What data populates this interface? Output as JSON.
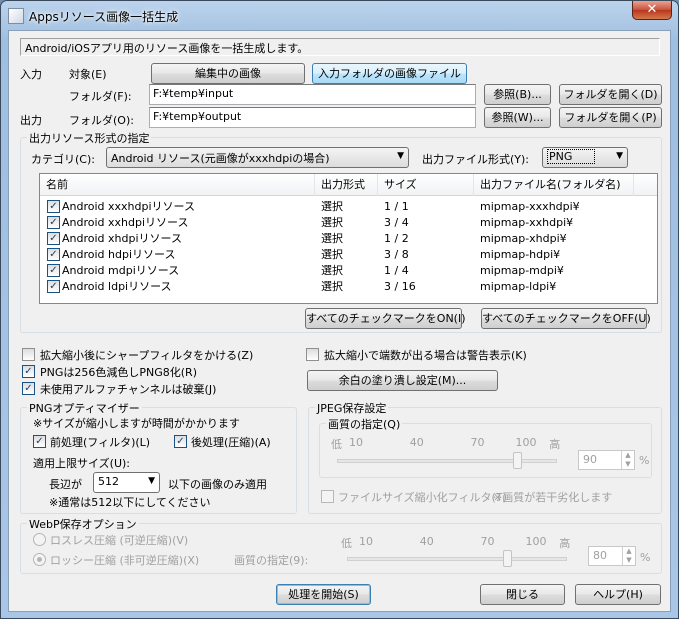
{
  "window": {
    "title": "Appsリソース画像一括生成",
    "close_label": "✕"
  },
  "description": "Android/iOSアプリ用のリソース画像を一括生成します。",
  "input": {
    "section_label": "入力",
    "target_label": "対象(E)",
    "target_btn_editing": "編集中の画像",
    "target_btn_folder": "入力フォルダの画像ファイル",
    "folder_label": "フォルダ(F):",
    "folder_value": "F:¥temp¥input",
    "browse_btn": "参照(B)...",
    "open_btn": "フォルダを開く(D)"
  },
  "output": {
    "section_label": "出力",
    "folder_label": "フォルダ(O):",
    "folder_value": "F:¥temp¥output",
    "browse_btn": "参照(W)...",
    "open_btn": "フォルダを開く(P)"
  },
  "resource_format": {
    "group_label": "出力リソース形式の指定",
    "category_label": "カテゴリ(C):",
    "category_value": "Android リソース(元画像がxxxhdpiの場合)",
    "file_format_label": "出力ファイル形式(Y):",
    "file_format_value": "PNG",
    "columns": [
      "名前",
      "出力形式",
      "サイズ",
      "出力ファイル名(フォルダ名)"
    ],
    "rows": [
      {
        "checked": true,
        "name": "Android xxxhdpiリソース",
        "format": "選択",
        "size": "1 / 1",
        "file": "mipmap-xxxhdpi¥"
      },
      {
        "checked": true,
        "name": "Android xxhdpiリソース",
        "format": "選択",
        "size": "3 / 4",
        "file": "mipmap-xxhdpi¥"
      },
      {
        "checked": true,
        "name": "Android xhdpiリソース",
        "format": "選択",
        "size": "1 / 2",
        "file": "mipmap-xhdpi¥"
      },
      {
        "checked": true,
        "name": "Android hdpiリソース",
        "format": "選択",
        "size": "3 / 8",
        "file": "mipmap-hdpi¥"
      },
      {
        "checked": true,
        "name": "Android mdpiリソース",
        "format": "選択",
        "size": "1 / 4",
        "file": "mipmap-mdpi¥"
      },
      {
        "checked": true,
        "name": "Android ldpiリソース",
        "format": "選択",
        "size": "3 / 16",
        "file": "mipmap-ldpi¥"
      }
    ],
    "check_all_on": "すべてのチェックマークをON(I)",
    "check_all_off": "すべてのチェックマークをOFF(U)"
  },
  "options": {
    "sharpen": {
      "checked": false,
      "label": "拡大縮小後にシャープフィルタをかける(Z)"
    },
    "png8": {
      "checked": true,
      "label": "PNGは256色減色しPNG8化(R)"
    },
    "discard_alpha": {
      "checked": true,
      "label": "未使用アルファチャンネルは破棄(J)"
    },
    "warn_fraction": {
      "checked": false,
      "label": "拡大縮小で端数が出る場合は警告表示(K)"
    },
    "margin_btn": "余白の塗り潰し設定(M)..."
  },
  "png_optimizer": {
    "group_label": "PNGオプティマイザー",
    "note": "※サイズが縮小しますが時間がかかります",
    "pre": {
      "checked": true,
      "label": "前処理(フィルタ)(L)"
    },
    "post": {
      "checked": true,
      "label": "後処理(圧縮)(A)"
    },
    "limit_label": "適用上限サイズ(U):",
    "long_side_label": "長辺が",
    "long_side_value": "512",
    "apply_suffix": "以下の画像のみ適用",
    "limit_note": "※通常は512以下にしてください"
  },
  "jpeg": {
    "group_label": "JPEG保存設定",
    "quality_label": "画質の指定(Q)",
    "scale": [
      "低",
      "10",
      "40",
      "70",
      "100",
      "高"
    ],
    "quality_value": "90",
    "quality_level": 90,
    "percent": "%",
    "filter_label": "ファイルサイズ縮小化フィルタ(T)",
    "filter_note": "※画質が若干劣化します"
  },
  "webp": {
    "group_label": "WebP保存オプション",
    "lossless_label": "ロスレス圧縮 (可逆圧縮)(V)",
    "lossy_label": "ロッシー圧縮 (非可逆圧縮)(X)",
    "quality_label": "画質の指定(9):",
    "scale": [
      "低",
      "10",
      "40",
      "70",
      "100",
      "高"
    ],
    "quality_value": "80",
    "quality_level": 80,
    "percent": "%"
  },
  "footer": {
    "start_btn": "処理を開始(S)",
    "close_btn": "閉じる",
    "help_btn": "ヘルプ(H)"
  }
}
